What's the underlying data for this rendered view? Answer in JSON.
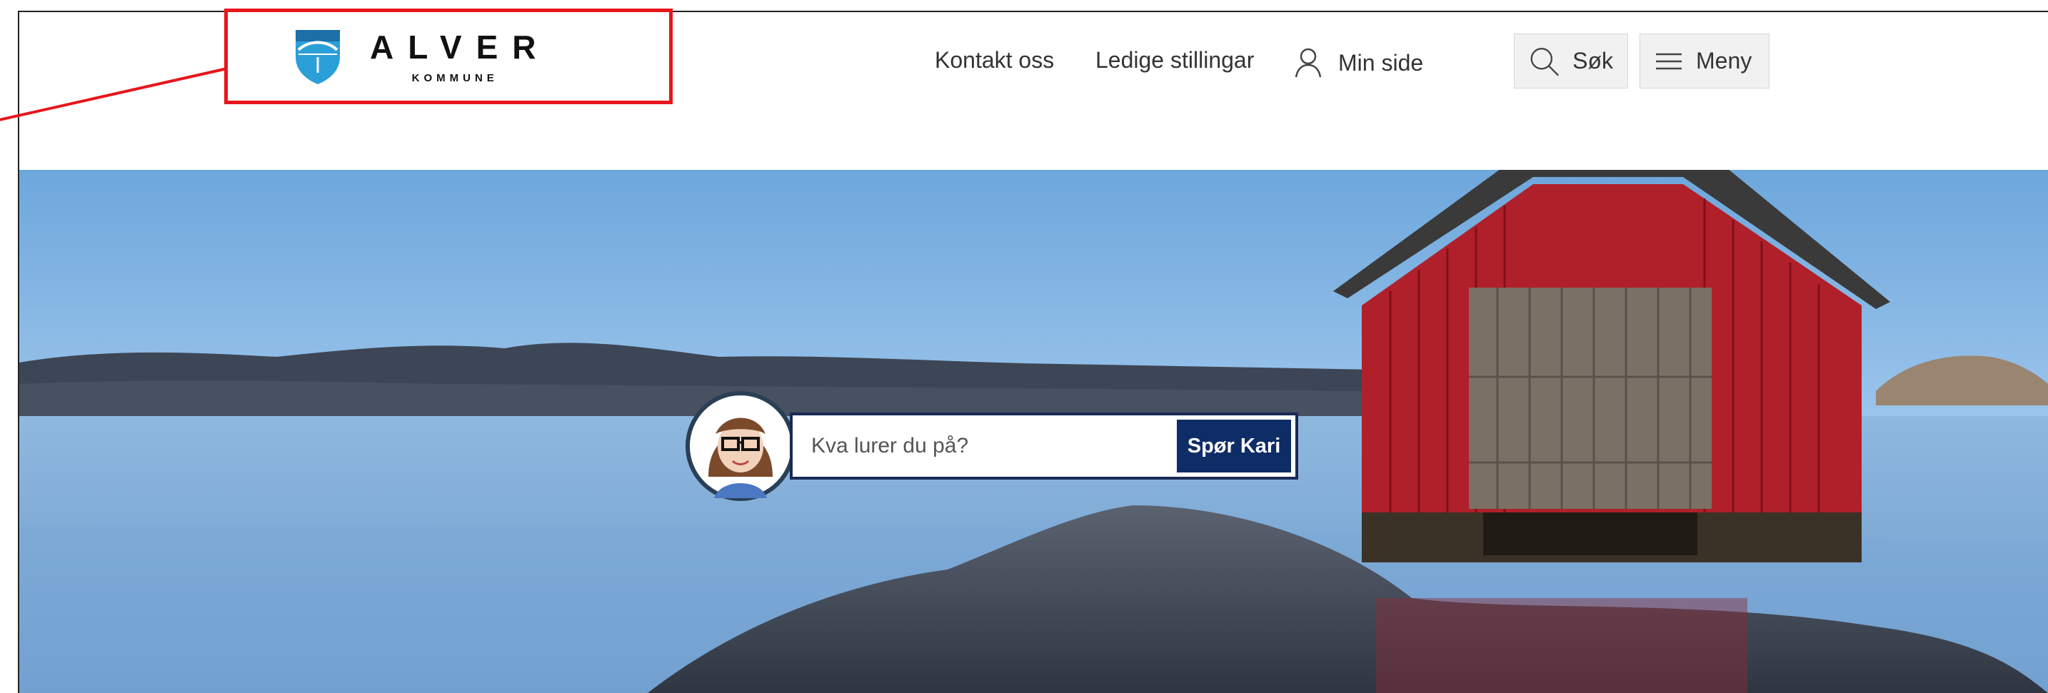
{
  "header": {
    "logo": {
      "name": "ALVER",
      "sub": "KOMMUNE"
    },
    "nav": {
      "contact": "Kontakt oss",
      "jobs": "Ledige stillingar",
      "my_page": "Min side"
    },
    "search_label": "Søk",
    "menu_label": "Meny"
  },
  "hero": {
    "ask": {
      "placeholder": "Kva lurer du på?",
      "button": "Spør Kari"
    }
  },
  "colors": {
    "annotation": "#e8151b",
    "brand_navy": "#0e2c66",
    "shield_blue": "#2a9fd8"
  },
  "icons": {
    "search": "search-icon",
    "menu": "hamburger-icon",
    "user": "user-icon",
    "avatar": "kari-avatar"
  }
}
